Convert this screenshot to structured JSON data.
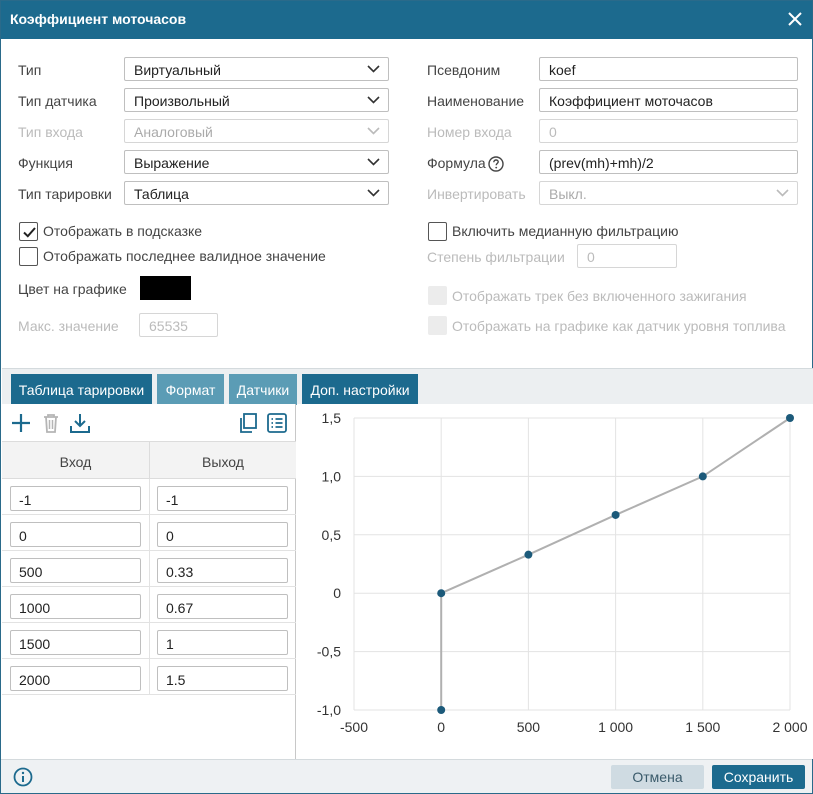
{
  "dialog": {
    "title": "Коэффициент моточасов"
  },
  "left_fields": [
    {
      "label": "Тип",
      "value": "Виртуальный",
      "disabled": false
    },
    {
      "label": "Тип датчика",
      "value": "Произвольный",
      "disabled": false
    },
    {
      "label": "Тип входа",
      "value": "Аналоговый",
      "disabled": true
    },
    {
      "label": "Функция",
      "value": "Выражение",
      "disabled": false
    },
    {
      "label": "Тип тарировки",
      "value": "Таблица",
      "disabled": false
    }
  ],
  "right_fields": {
    "alias": {
      "label": "Псевдоним",
      "value": "koef"
    },
    "name": {
      "label": "Наименование",
      "value": "Коэффициент моточасов"
    },
    "input_number": {
      "label": "Номер входа",
      "value": "0"
    },
    "formula": {
      "label": "Формула",
      "value": "(prev(mh)+mh)/2"
    },
    "invert": {
      "label": "Инвертировать",
      "value": "Выкл."
    }
  },
  "checkboxes": {
    "show_in_tooltip": {
      "label": "Отображать в подсказке",
      "checked": true
    },
    "show_last_valid": {
      "label": "Отображать последнее валидное значение",
      "checked": false
    },
    "median_filter": {
      "label": "Включить медианную фильтрацию",
      "checked": false
    },
    "track_without_ignition": {
      "label": "Отображать трек без включенного зажигания",
      "checked": false
    },
    "fuel_level_chart": {
      "label": "Отображать на графике как датчик уровня топлива",
      "checked": false
    }
  },
  "filter_degree": {
    "label": "Степень фильтрации",
    "value": "0"
  },
  "chart_color": {
    "label": "Цвет на графике",
    "value": "#000000"
  },
  "max_value": {
    "label": "Макс. значение",
    "value": "65535"
  },
  "tabs": [
    {
      "label": "Таблица тарировки",
      "color": "#1c6a8e"
    },
    {
      "label": "Формат",
      "color": "#5b9cb5"
    },
    {
      "label": "Датчики",
      "color": "#5b9cb5"
    },
    {
      "label": "Доп. настройки",
      "color": "#1c6a8e"
    }
  ],
  "table": {
    "headers": [
      "Вход",
      "Выход"
    ],
    "rows": [
      {
        "in": "-1",
        "out": "-1"
      },
      {
        "in": "0",
        "out": "0"
      },
      {
        "in": "500",
        "out": "0.33"
      },
      {
        "in": "1000",
        "out": "0.67"
      },
      {
        "in": "1500",
        "out": "1"
      },
      {
        "in": "2000",
        "out": "1.5"
      }
    ]
  },
  "chart_data": {
    "type": "line",
    "x": [
      0,
      0,
      500,
      1000,
      1500,
      2000
    ],
    "y": [
      -1,
      0,
      0.33,
      0.67,
      1,
      1.5
    ],
    "xlim": [
      -500,
      2000
    ],
    "ylim": [
      -1,
      1.5
    ],
    "x_ticks": [
      -500,
      0,
      500,
      1000,
      1500,
      2000
    ],
    "x_tick_labels": [
      "-500",
      "0",
      "500",
      "1 000",
      "1 500",
      "2 000"
    ],
    "y_ticks": [
      -1,
      -0.5,
      0,
      0.5,
      1,
      1.5
    ],
    "y_tick_labels": [
      "-1,0",
      "-0,5",
      "0",
      "0,5",
      "1,0",
      "1,5"
    ],
    "grid": true,
    "line_color": "#b0b0b0",
    "point_color": "#1c5a7a"
  },
  "footer": {
    "cancel_label": "Отмена",
    "save_label": "Сохранить"
  },
  "colors": {
    "accent": "#1c6a8e",
    "accent_light": "#5b9cb5"
  }
}
